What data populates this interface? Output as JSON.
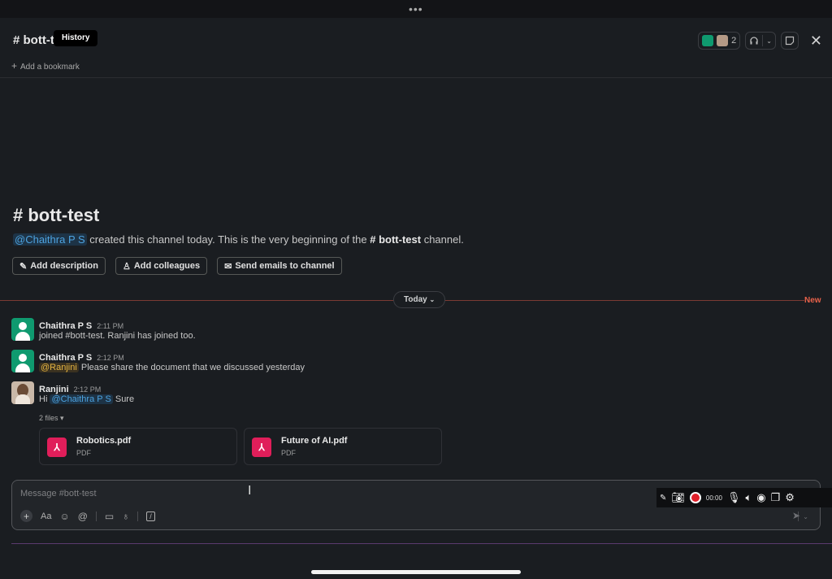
{
  "header": {
    "channel_title": "# bott-t",
    "tooltip": "History",
    "bookmark_label": "Add a bookmark",
    "member_count": "2"
  },
  "intro": {
    "title": "# bott-test",
    "creator": "@Chaithra P S",
    "text_before": " created this channel today. This is the very beginning of the ",
    "channel": "# bott-test",
    "text_after": " channel.",
    "buttons": [
      "Add description",
      "Add colleagues",
      "Send emails to channel"
    ]
  },
  "divider": {
    "label": "Today",
    "new_label": "New"
  },
  "messages": [
    {
      "user": "Chaithra P S",
      "time": "2:11 PM",
      "text": "joined #bott-test. Ranjini has joined too."
    },
    {
      "user": "Chaithra P S",
      "time": "2:12 PM",
      "mention": "@Ranjini",
      "text": " Please share the document that we discussed yesterday"
    },
    {
      "user": "Ranjini",
      "time": "2:12 PM",
      "prefix": "Hi ",
      "mention": "@Chaithra P S",
      "text": " Sure"
    }
  ],
  "files": {
    "label": "2 files",
    "items": [
      {
        "name": "Robotics.pdf",
        "type": "PDF"
      },
      {
        "name": "Future of AI.pdf",
        "type": "PDF"
      }
    ]
  },
  "composer": {
    "placeholder": "Message #bott-test"
  },
  "recorder": {
    "time": "00:00"
  },
  "colors": {
    "accent_mention": "#4da3e0",
    "pdf_icon": "#e01e5a",
    "new_divider": "#e8624a"
  }
}
